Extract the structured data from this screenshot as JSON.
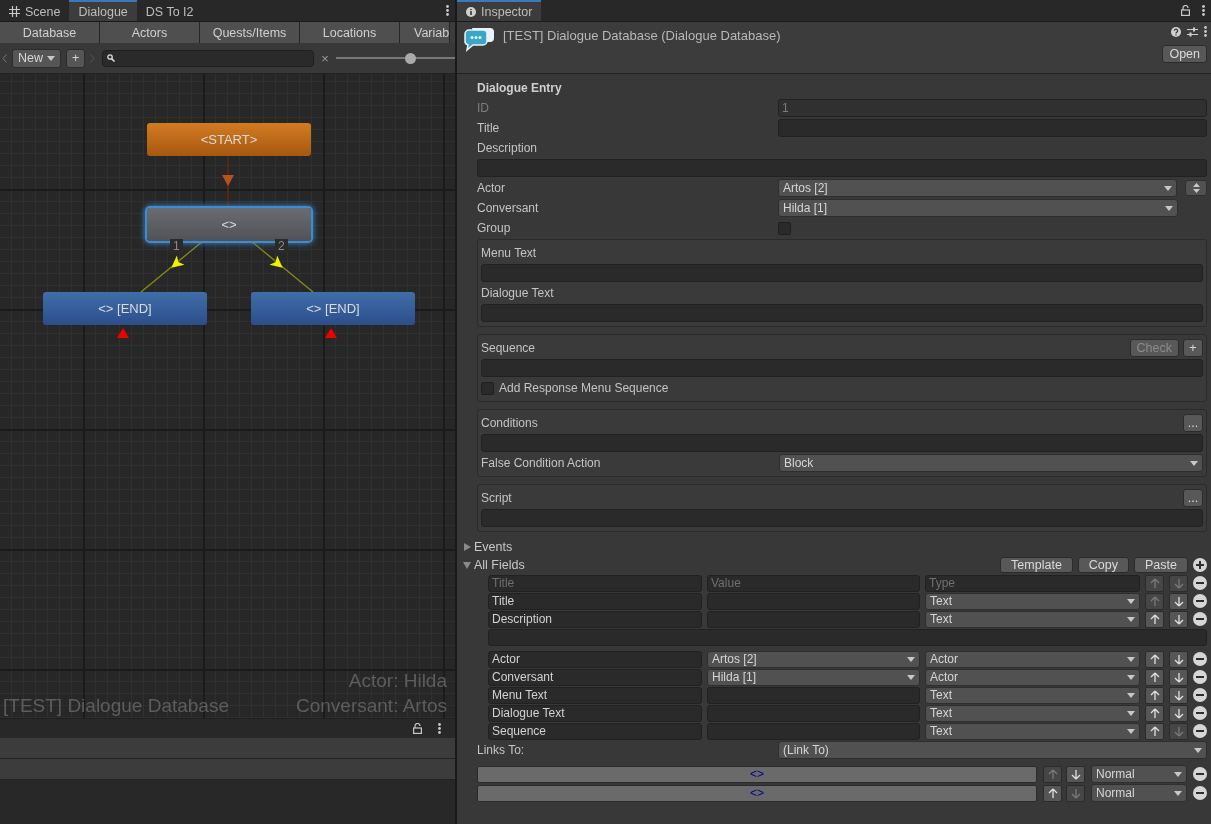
{
  "left_panel": {
    "tabs": [
      {
        "label": "Scene",
        "kind": "scene",
        "selected": false
      },
      {
        "label": "Dialogue",
        "kind": "plain",
        "selected": true
      },
      {
        "label": "DS To I2",
        "kind": "plain",
        "selected": false
      }
    ],
    "section_tabs": [
      {
        "label": "Database",
        "selected": false
      },
      {
        "label": "Actors",
        "selected": false
      },
      {
        "label": "Quests/Items",
        "selected": false
      },
      {
        "label": "Locations",
        "selected": false
      },
      {
        "label": "Variab",
        "selected": false
      }
    ],
    "toolbar": {
      "new_menu": "New",
      "add_button": "+",
      "clear_button": "×",
      "zoom_slider": {
        "level": 0.54
      }
    },
    "graph": {
      "nodes": [
        {
          "label": "<START>",
          "kind": "start",
          "selected": false
        },
        {
          "label": "<>",
          "kind": "dialogue",
          "selected": true
        },
        {
          "label": "<> [END]",
          "kind": "end",
          "selected": false
        },
        {
          "label": "<> [END]",
          "kind": "end",
          "selected": false
        }
      ],
      "links": [
        {
          "label": "1"
        },
        {
          "label": "2"
        }
      ],
      "database_name": "[TEST] Dialogue Database",
      "actor": "Actor: Hilda",
      "conversant": "Conversant: Artos"
    }
  },
  "inspector": {
    "tab": "Inspector",
    "title": "[TEST] Dialogue Database (Dialogue Database)",
    "open_button": "Open",
    "entry_heading": "Dialogue Entry",
    "fields": [
      {
        "kind": "text",
        "label": "ID",
        "value": "1",
        "disabled": true
      },
      {
        "kind": "text",
        "label": "Title",
        "disabled": false
      },
      {
        "kind": "wide",
        "label": "Description",
        "disabled": false
      },
      {
        "kind": "dropdown",
        "label": "Actor",
        "value": "Artos [2]",
        "side_button": true,
        "disabled": false
      },
      {
        "kind": "dropdown",
        "label": "Conversant",
        "value": "Hilda [1]",
        "side_button": false,
        "disabled": false
      },
      {
        "kind": "checkbox",
        "label": "Group",
        "checked": false,
        "disabled": false
      }
    ],
    "boxes": [
      {
        "rows": [
          {
            "kind": "heading",
            "label": "Menu Text"
          },
          {
            "kind": "field"
          },
          {
            "kind": "heading",
            "label": "Dialogue Text"
          },
          {
            "kind": "field"
          }
        ]
      },
      {
        "rows": [
          {
            "kind": "heading",
            "label": "Sequence",
            "buttons": [
              {
                "label": "Check",
                "disabled": true
              },
              {
                "label": "+",
                "disabled": false
              }
            ]
          },
          {
            "kind": "field"
          },
          {
            "kind": "checkbox",
            "label": "Add Response Menu Sequence",
            "checked": false
          }
        ]
      },
      {
        "rows": [
          {
            "kind": "heading",
            "label": "Conditions",
            "buttons": [
              {
                "label": "...",
                "disabled": false
              }
            ]
          },
          {
            "kind": "field"
          },
          {
            "kind": "dropdown",
            "label": "False Condition Action",
            "value": "Block"
          }
        ]
      },
      {
        "rows": [
          {
            "kind": "heading",
            "label": "Script",
            "buttons": [
              {
                "label": "...",
                "disabled": false
              }
            ]
          },
          {
            "kind": "field"
          }
        ]
      }
    ],
    "foldouts": [
      {
        "label": "Events",
        "expanded": false
      },
      {
        "label": "All Fields",
        "expanded": true
      }
    ],
    "all_fields_buttons": [
      "Template",
      "Copy",
      "Paste"
    ],
    "field_table": [
      {
        "kind": "new",
        "title_placeholder": "Title",
        "value_placeholder": "Value",
        "type_placeholder": "Type",
        "up_disabled": true,
        "down_disabled": true
      },
      {
        "kind": "field",
        "title": "Title",
        "type": "Text",
        "up_disabled": true,
        "down_disabled": false
      },
      {
        "kind": "field",
        "title": "Description",
        "type": "Text",
        "up_disabled": false,
        "down_disabled": false
      },
      {
        "kind": "wide_value"
      },
      {
        "kind": "field",
        "title": "Actor",
        "value": "Artos [2]",
        "type": "Actor",
        "up_disabled": false,
        "down_disabled": false
      },
      {
        "kind": "field",
        "title": "Conversant",
        "value": "Hilda [1]",
        "type": "Actor",
        "up_disabled": false,
        "down_disabled": false
      },
      {
        "kind": "field",
        "title": "Menu Text",
        "type": "Text",
        "up_disabled": false,
        "down_disabled": false
      },
      {
        "kind": "field",
        "title": "Dialogue Text",
        "type": "Text",
        "up_disabled": false,
        "down_disabled": false
      },
      {
        "kind": "field",
        "title": "Sequence",
        "type": "Text",
        "up_disabled": false,
        "down_disabled": true
      }
    ],
    "links_to": {
      "label": "Links To:",
      "value": "(Link To)"
    },
    "links": [
      {
        "target": "<>",
        "up_disabled": true,
        "down_disabled": false,
        "priority": "Normal"
      },
      {
        "target": "<>",
        "up_disabled": false,
        "down_disabled": true,
        "priority": "Normal"
      }
    ]
  }
}
